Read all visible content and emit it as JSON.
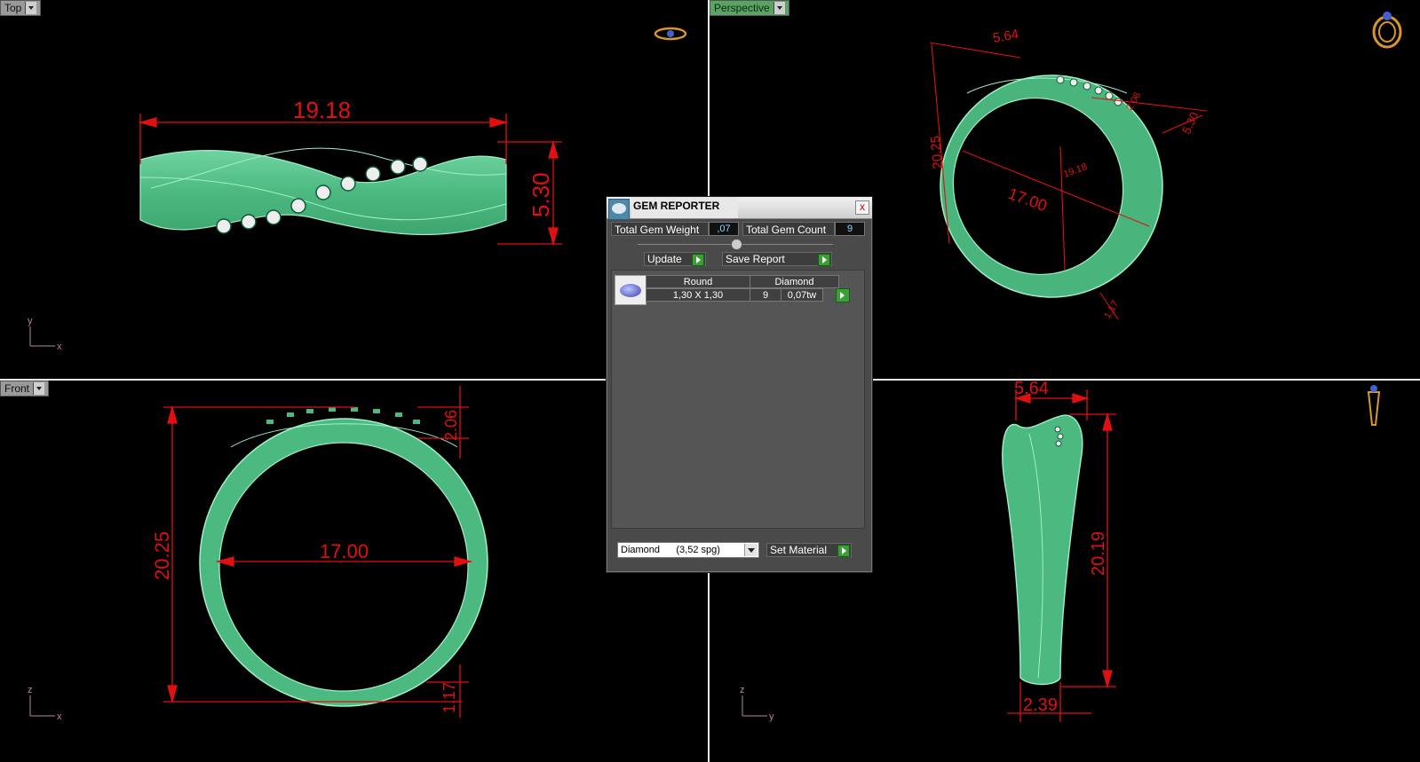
{
  "viewports": {
    "top": {
      "label": "Top",
      "dimensions": {
        "width": "19.18",
        "height": "5.30"
      },
      "axis": {
        "v": "y",
        "h": "x"
      }
    },
    "perspective": {
      "label": "Perspective",
      "dimensions": {
        "a": "5.64",
        "b": "20.25",
        "c": "17.00",
        "d": "5.30",
        "e": "19.18",
        "f": "1.17",
        "g": "2.06"
      }
    },
    "front": {
      "label": "Front",
      "dimensions": {
        "outer": "20.25",
        "inner": "17.00",
        "top": "2.06",
        "bottom": "1.17"
      },
      "axis": {
        "v": "z",
        "h": "x"
      }
    },
    "right": {
      "dimensions": {
        "width": "5.64",
        "height": "20.19",
        "bottom": "2.39"
      },
      "axis": {
        "v": "z",
        "h": "y"
      }
    }
  },
  "gem_reporter": {
    "title": "GEM REPORTER",
    "close": "x",
    "total_gem_weight_label": "Total Gem Weight",
    "total_gem_weight": ",07",
    "total_gem_count_label": "Total Gem Count",
    "total_gem_count": "9",
    "update_label": "Update",
    "save_report_label": "Save Report",
    "list": {
      "headers": [
        "Round",
        "Diamond"
      ],
      "rows": [
        {
          "size": "1,30 X 1,30",
          "count": "9",
          "weight": "0,07tw"
        }
      ]
    },
    "material_selected": "Diamond      (3,52 spg)",
    "set_material_label": "Set Material"
  }
}
